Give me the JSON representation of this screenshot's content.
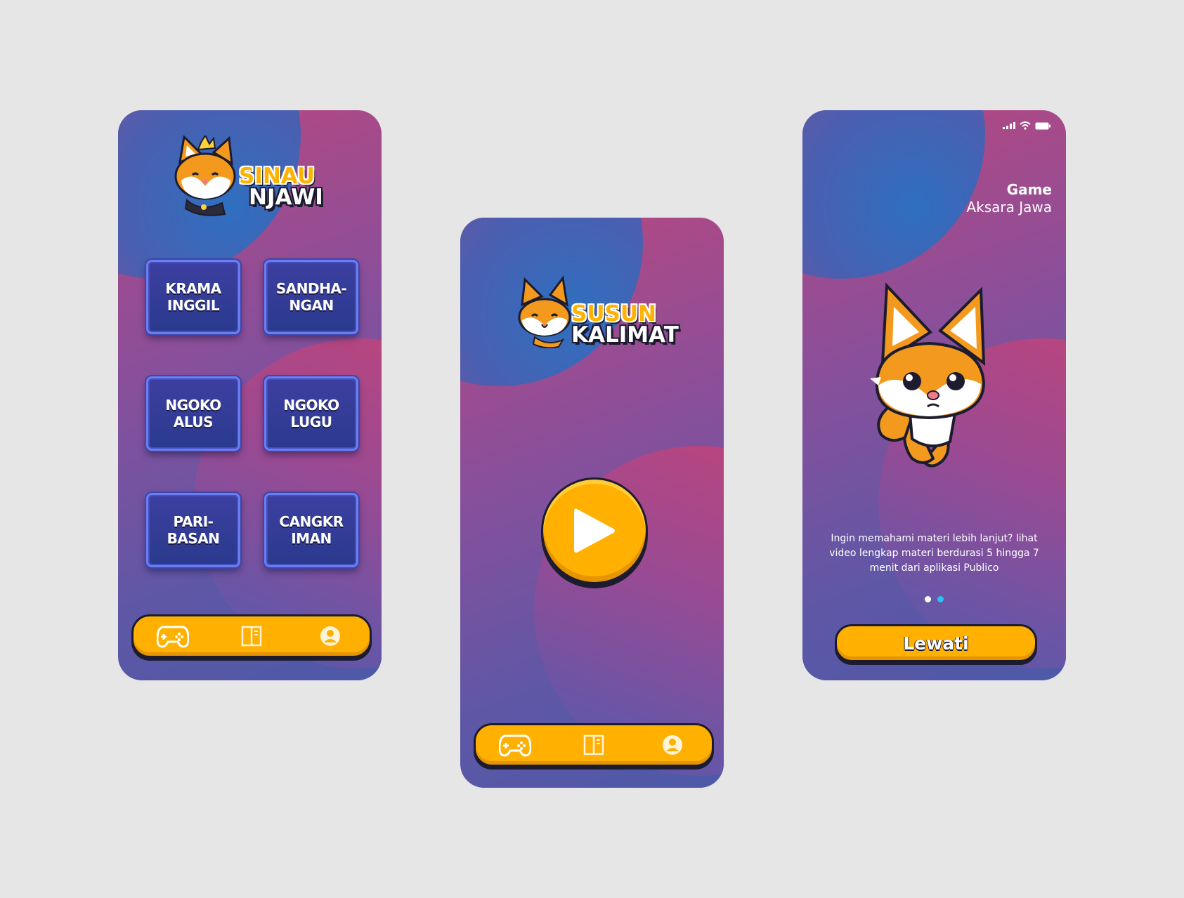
{
  "screen1": {
    "logo": {
      "line1": "SINAU",
      "line2": "NJAWI"
    },
    "tiles": [
      {
        "label": "KRAMA\nINGGIL"
      },
      {
        "label": "SANDHA-\nNGAN"
      },
      {
        "label": "NGOKO\nALUS"
      },
      {
        "label": "NGOKO\nLUGU"
      },
      {
        "label": "PARI-\nBASAN"
      },
      {
        "label": "CANGKR\nIMAN"
      }
    ],
    "nav": [
      "gamepad-icon",
      "book-icon",
      "profile-icon"
    ]
  },
  "screen2": {
    "logo": {
      "line1": "SUSUN",
      "line2": "KALIMAT"
    },
    "play_icon": "play-icon",
    "nav": [
      "gamepad-icon",
      "book-icon",
      "profile-icon"
    ]
  },
  "screen3": {
    "title": "Game",
    "subtitle": "Aksara Jawa",
    "description": "Ingin memahami materi lebih lanjut? lihat video lengkap materi berdurasi 5 hingga 7 menit dari aplikasi Publico",
    "pagination": {
      "count": 2,
      "active": 2
    },
    "skip_label": "Lewati"
  },
  "colors": {
    "background": "#e6e6e6",
    "accent": "#ffb000",
    "tile": "#2f3c93",
    "dot_active": "#29c3ef",
    "dot_inactive": "#ffffff"
  }
}
